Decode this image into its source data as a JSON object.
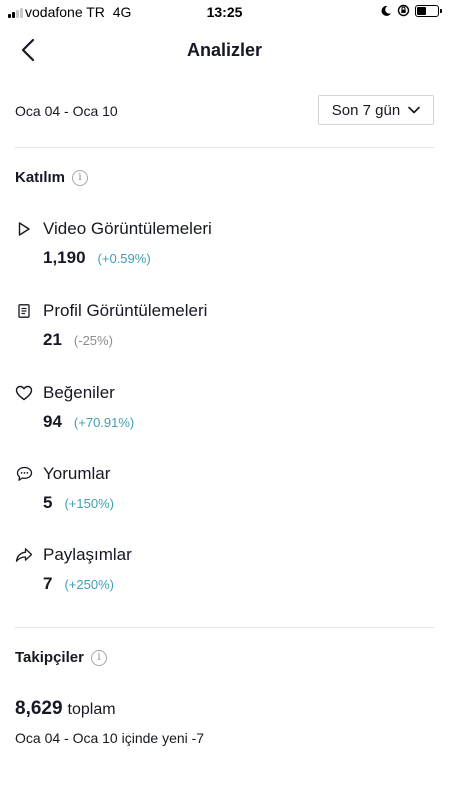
{
  "status_bar": {
    "carrier": "vodafone TR",
    "network": "4G",
    "time": "13:25"
  },
  "header": {
    "title": "Analizler",
    "back_icon": "chevron-left-icon"
  },
  "filter": {
    "date_range": "Oca 04 - Oca 10",
    "period": "Son 7 gün"
  },
  "engagement": {
    "title": "Katılım",
    "metrics": [
      {
        "icon": "play-icon",
        "label": "Video Görüntülemeleri",
        "value": "1,190",
        "change": "(+0.59%)",
        "trend": "positive"
      },
      {
        "icon": "profile-icon",
        "label": "Profil Görüntülemeleri",
        "value": "21",
        "change": "(-25%)",
        "trend": "negative"
      },
      {
        "icon": "heart-icon",
        "label": "Beğeniler",
        "value": "94",
        "change": "(+70.91%)",
        "trend": "positive"
      },
      {
        "icon": "comment-icon",
        "label": "Yorumlar",
        "value": "5",
        "change": "(+150%)",
        "trend": "positive"
      },
      {
        "icon": "share-icon",
        "label": "Paylaşımlar",
        "value": "7",
        "change": "(+250%)",
        "trend": "positive"
      }
    ]
  },
  "followers": {
    "title": "Takipçiler",
    "total": "8,629",
    "total_unit": "toplam",
    "new_summary": "Oca 04 - Oca 10 içinde yeni -7"
  },
  "colors": {
    "positive": "#3f9fb5",
    "negative": "#8a8b91",
    "text": "#161823",
    "divider": "#e3e3e4"
  }
}
